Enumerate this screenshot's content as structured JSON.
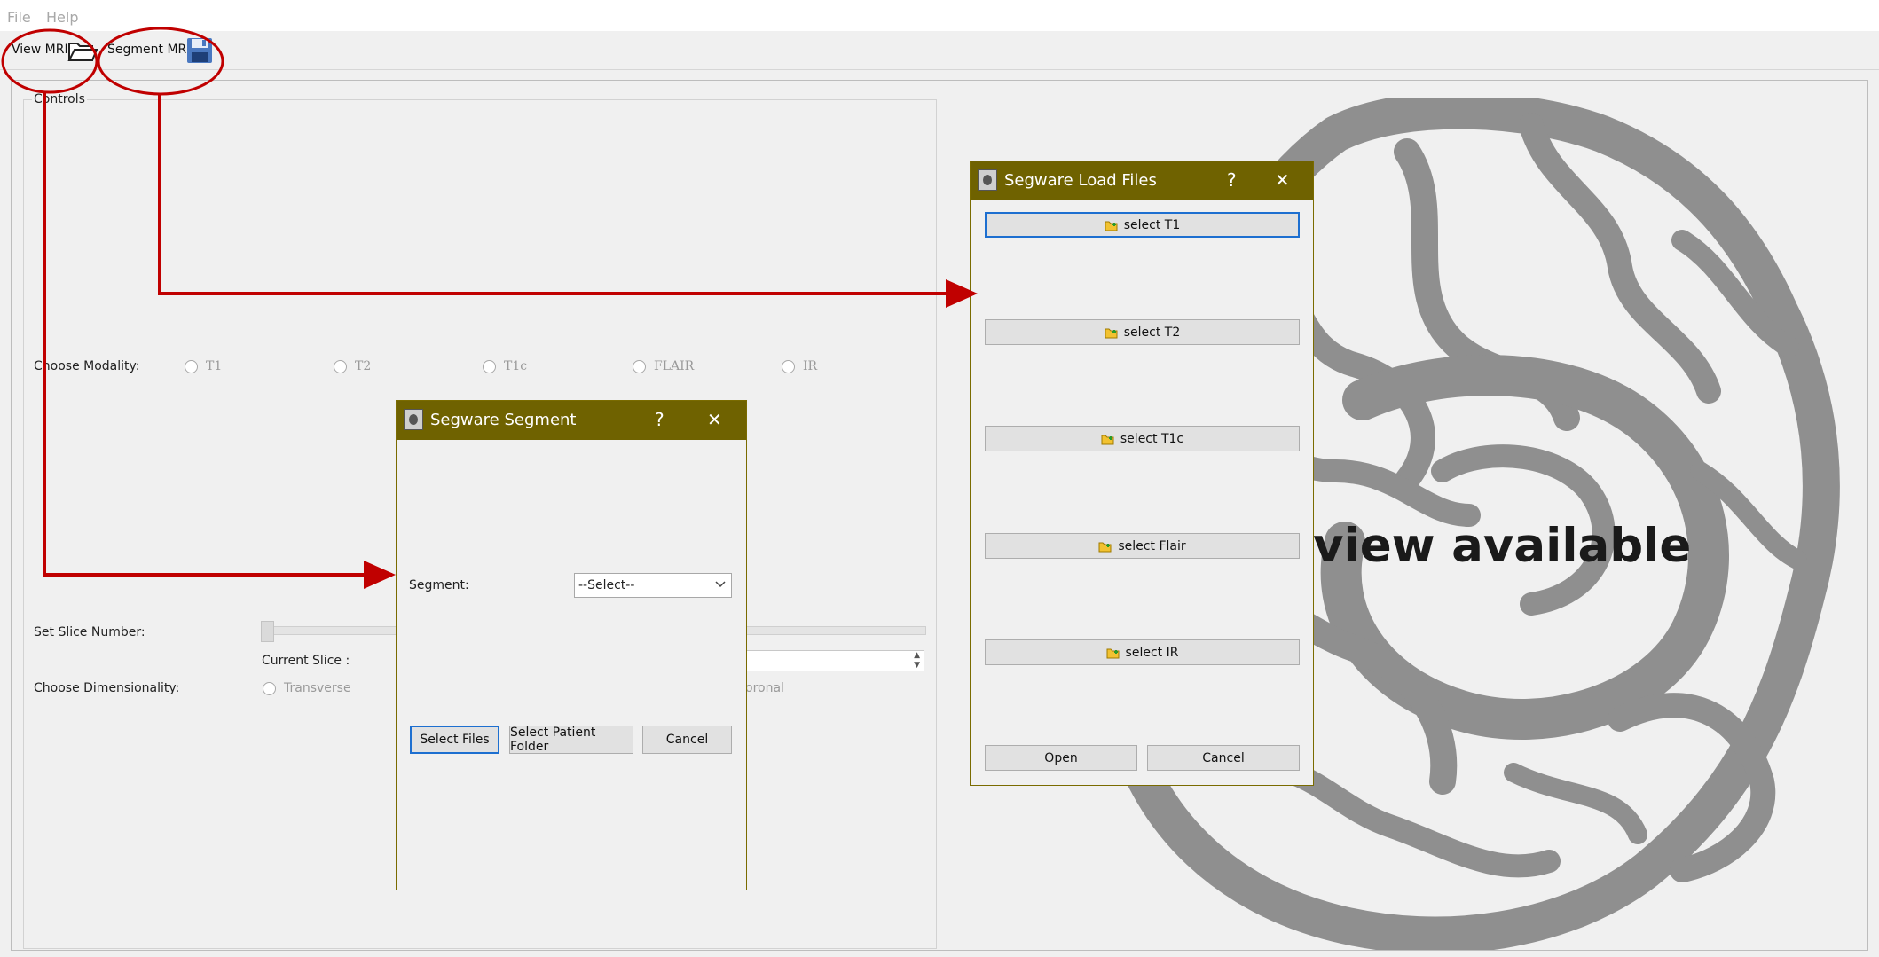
{
  "menu": {
    "file": "File",
    "help": "Help"
  },
  "toolbar": {
    "view_mri": "View MRI",
    "segment_mri": "Segment MRI"
  },
  "controls": {
    "title": "Controls",
    "modality_label": "Choose Modality:",
    "modalities": [
      "T1",
      "T2",
      "T1c",
      "FLAIR",
      "IR"
    ],
    "slice_label": "Set Slice Number:",
    "current_slice_label": "Current Slice :",
    "dimensionality_label": "Choose Dimensionality:",
    "dim_transverse": "Transverse",
    "dim_coronal_fragment": "oronal"
  },
  "preview": {
    "text_fragment": "view available"
  },
  "segment_dialog": {
    "title": "Segware Segment",
    "help_glyph": "?",
    "close_glyph": "✕",
    "segment_label": "Segment:",
    "select_value": "--Select--",
    "buttons": {
      "select_files": "Select Files",
      "select_patient_folder": "Select Patient Folder",
      "cancel": "Cancel"
    }
  },
  "load_dialog": {
    "title": "Segware Load Files",
    "help_glyph": "?",
    "close_glyph": "✕",
    "buttons": [
      "select T1",
      "select T2",
      "select T1c",
      "select Flair",
      "select IR"
    ],
    "open": "Open",
    "cancel": "Cancel"
  },
  "colors": {
    "dialog_title_bar": "#6f6200",
    "annotation_red": "#c00000",
    "focus_blue": "#1d6fd0",
    "window_bg": "#f0f0f0"
  },
  "icons": {
    "view_mri": "open-folder-icon",
    "segment_mri": "floppy-disk-icon",
    "file_buttons": "folder-add-icon"
  }
}
